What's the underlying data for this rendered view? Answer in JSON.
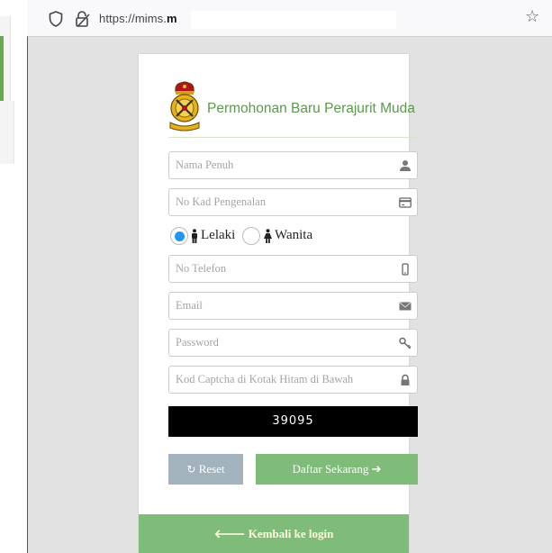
{
  "browser": {
    "url_prefix": "https://mims.",
    "url_domain_char": "m",
    "icons": [
      "shield-icon",
      "lock-insecure-icon",
      "bookmark-star-icon"
    ]
  },
  "form": {
    "title": "Permohonan Baru Perajurit Muda",
    "fields": {
      "nama": {
        "placeholder": "Nama Penuh",
        "value": "",
        "icon": "user-icon"
      },
      "ic": {
        "placeholder": "No Kad Pengenalan",
        "value": "",
        "icon": "id-card-icon"
      },
      "telefon": {
        "placeholder": "No Telefon",
        "value": "",
        "icon": "mobile-phone-icon"
      },
      "email": {
        "placeholder": "Email",
        "value": "",
        "icon": "envelope-icon"
      },
      "password": {
        "placeholder": "Password",
        "value": "",
        "icon": "key-icon"
      },
      "captcha": {
        "placeholder": "Kod Captcha di Kotak Hitam di Bawah",
        "value": "",
        "icon": "lock-icon"
      }
    },
    "gender": {
      "selected": "Lelaki",
      "options": [
        {
          "label": "Lelaki",
          "icon": "male-icon"
        },
        {
          "label": "Wanita",
          "icon": "female-icon"
        }
      ]
    },
    "captcha_code": "39095",
    "buttons": {
      "reset": "Reset",
      "submit": "Daftar Sekarang"
    },
    "footer_link": "Kembali ke login"
  },
  "colors": {
    "accent_green": "#7fbc7a",
    "title_green": "#5a9a48",
    "radio_blue": "#2196f3",
    "reset_gray": "#a3b3bd"
  }
}
